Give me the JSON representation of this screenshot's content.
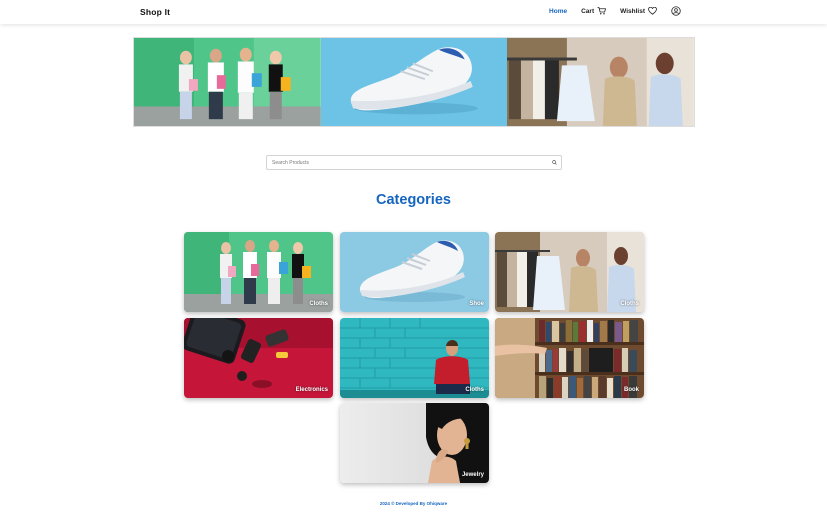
{
  "navbar": {
    "brand": "Shop It",
    "links": [
      {
        "label": "Home",
        "active": true
      },
      {
        "label": "Cart",
        "icon": "cart-icon"
      },
      {
        "label": "Wishlist",
        "icon": "heart-icon"
      }
    ],
    "profile_icon": "user-circle-icon",
    "active_color": "#1565c0"
  },
  "hero": {
    "slides": [
      "shopping-friends-photo",
      "sneaker-photo",
      "clothing-store-photo"
    ]
  },
  "search": {
    "placeholder": "Search Products",
    "value": "",
    "icon": "search-icon"
  },
  "categories": {
    "title": "Categories",
    "items": [
      {
        "label": "Cloths",
        "image": "shopping-friends-photo"
      },
      {
        "label": "Shoe",
        "image": "sneaker-photo"
      },
      {
        "label": "Cloths",
        "image": "clothing-store-photo"
      },
      {
        "label": "Electronics",
        "image": "electronics-photo"
      },
      {
        "label": "Cloths",
        "image": "man-red-sweater-photo"
      },
      {
        "label": "Book",
        "image": "bookshelf-photo"
      },
      {
        "label": "Jewelry",
        "image": "woman-earring-photo"
      }
    ]
  },
  "footer": {
    "text": "2024 © Developed By Ohiqware"
  }
}
